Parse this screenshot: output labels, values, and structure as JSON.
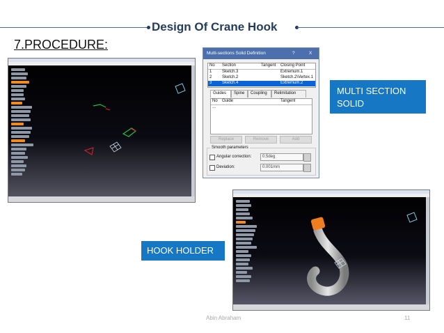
{
  "header": {
    "title": "Design Of Crane Hook",
    "section_heading": "7.PROCEDURE:"
  },
  "dialog": {
    "title": "Multi-sections Solid Definition",
    "help_button": "?",
    "close_button": "X",
    "table_headers": [
      "No",
      "Section",
      "Tangent",
      "Closing Point"
    ],
    "rows": [
      {
        "no": "1",
        "section": "Sketch.3",
        "tangent": "",
        "closing_point": "Extremum.1",
        "selected": false
      },
      {
        "no": "2",
        "section": "Sketch.2",
        "tangent": "",
        "closing_point": "Sketch.2\\Vertex.1",
        "selected": false
      },
      {
        "no": "3",
        "section": "Sketch.4",
        "tangent": "",
        "closing_point": "Extremum.2",
        "selected": true
      }
    ],
    "tabs": [
      "Guides",
      "Spine",
      "Coupling",
      "Relimitation"
    ],
    "active_tab": "Guides",
    "guide_headers": [
      "No",
      "Guide",
      "Tangent"
    ],
    "guide_rows": [
      "..."
    ],
    "buttons": [
      "Replace",
      "Remove",
      "Add"
    ],
    "smooth_group_title": "Smooth parameters",
    "angular_label": "Angular correction:",
    "angular_value": "0.5deg",
    "deviation_label": "Deviation:",
    "deviation_value": "0.001mm"
  },
  "callouts": {
    "multi_section": "MULTI SECTION SOLID",
    "hook_holder": "HOOK HOLDER"
  },
  "footer": {
    "author": "Abin Abraham",
    "page_number": "11"
  },
  "colors": {
    "header_text": "#253d5c",
    "callout_bg": "#1677c4",
    "dialog_title_bg": "#4b70ad",
    "selected_row": "#0a64d8",
    "hook_gray": "#c8c8c8",
    "hook_orange": "#f07e1e"
  }
}
